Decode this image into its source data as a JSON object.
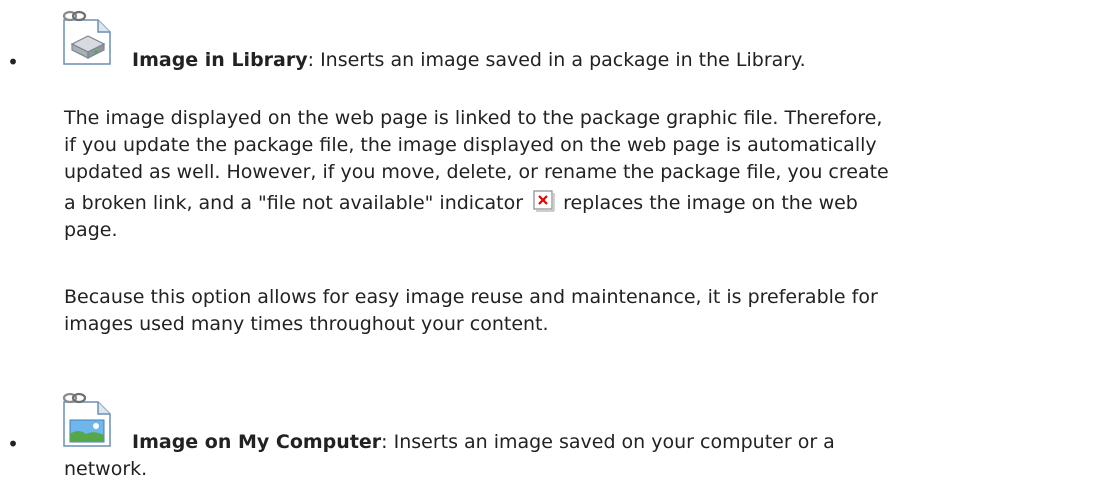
{
  "items": [
    {
      "icon": "library-package-image-icon",
      "title": "Image in Library",
      "description": ": Inserts an image saved in a package in the Library."
    },
    {
      "icon": "computer-image-icon",
      "title": "Image on My Computer",
      "description": ": Inserts an image saved on your computer or a",
      "description_cont": "network."
    }
  ],
  "paragraph1": {
    "line1": "The image displayed on the web page is linked to the package graphic file. Therefore,",
    "line2": "if you update the package file, the image displayed on the web page is automatically",
    "line3": "updated as well. However, if you move, delete, or rename the package file, you create",
    "line4_before": "a broken link, and a \"file not available\" indicator",
    "line4_after": "replaces the image on the web",
    "line5": "page.",
    "indicator_icon": "file-not-available-icon"
  },
  "paragraph2": {
    "line1": "Because this option allows for easy image reuse and maintenance, it is preferable for",
    "line2": "images used many times throughout your content."
  },
  "bullet": "•"
}
